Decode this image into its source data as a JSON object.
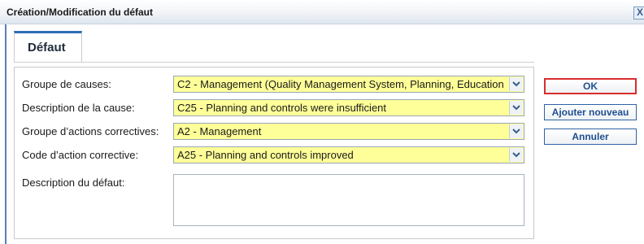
{
  "dialog": {
    "title": "Création/Modification du défaut",
    "close_glyph": "X"
  },
  "tabs": [
    {
      "label": "Défaut",
      "active": true
    }
  ],
  "form": {
    "fields": [
      {
        "label": "Groupe de causes:",
        "value": "C2 - Management (Quality Management System, Planning, Education"
      },
      {
        "label": "Description de la cause:",
        "value": "C25 - Planning and controls were insufficient"
      },
      {
        "label": "Groupe d’actions correctives:",
        "value": "A2 - Management"
      },
      {
        "label": "Code d’action corrective:",
        "value": "A25 - Planning and controls improved"
      }
    ],
    "description": {
      "label": "Description du défaut:",
      "value": ""
    }
  },
  "buttons": {
    "ok": "OK",
    "add_new": "Ajouter nouveau",
    "cancel": "Annuler"
  },
  "colors": {
    "field_highlight": "#ffff99",
    "button_text": "#1f4f90",
    "ok_focus_border": "#d92d2d",
    "tab_accent": "#2f6db5"
  },
  "icons": {
    "dropdown": "chevron-down-icon",
    "close": "close-icon"
  }
}
